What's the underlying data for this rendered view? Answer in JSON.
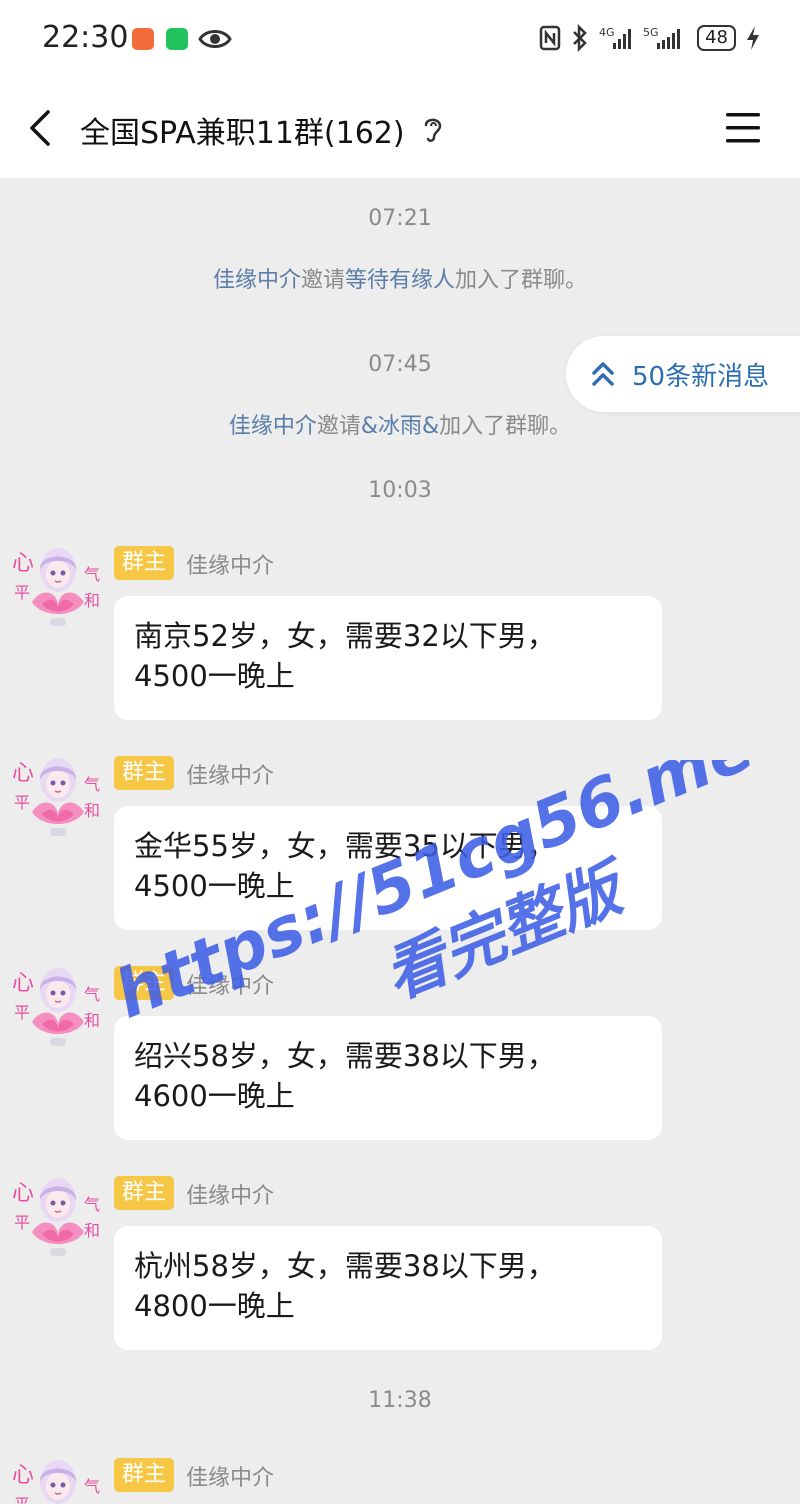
{
  "status_bar": {
    "time": "22:30",
    "battery": "48",
    "icons": [
      "nfc-icon",
      "bluetooth-icon",
      "4g-signal-icon",
      "5g-signal-icon",
      "charging-icon"
    ]
  },
  "header": {
    "title": "全国SPA兼职11群(162)",
    "back_icon": "chevron-left-icon",
    "menu_icon": "hamburger-menu-icon"
  },
  "new_messages": {
    "label": "50条新消息"
  },
  "timeline": {
    "t1": "07:21",
    "sys1": {
      "inviter": "佳缘中介",
      "verb": "邀请",
      "invitee": "等待有缘人",
      "suffix": "加入了群聊。"
    },
    "t2": "07:45",
    "sys2": {
      "inviter": "佳缘中介",
      "verb": "邀请",
      "invitee": "&冰雨&",
      "suffix": "加入了群聊。"
    },
    "t3": "10:03",
    "t4": "11:38"
  },
  "messages": [
    {
      "badge": "群主",
      "sender": "佳缘中介",
      "line1": "南京52岁，女，需要32以下男，",
      "line2": "4500一晚上"
    },
    {
      "badge": "群主",
      "sender": "佳缘中介",
      "line1": "金华55岁，女，需要35以下男，",
      "line2": "4500一晚上"
    },
    {
      "badge": "群主",
      "sender": "佳缘中介",
      "line1": "绍兴58岁，女，需要38以下男，",
      "line2": "4600一晚上"
    },
    {
      "badge": "群主",
      "sender": "佳缘中介",
      "line1": "杭州58岁，女，需要38以下男，",
      "line2": "4800一晚上"
    },
    {
      "badge": "群主",
      "sender": "佳缘中介"
    }
  ],
  "watermark": {
    "url": "https://51cg56.me",
    "caption": "看完整版"
  },
  "colors": {
    "accent": "#2e6db2",
    "badge": "#f6c744",
    "link": "#5a7ea8",
    "watermark": "#3f5fe6"
  }
}
